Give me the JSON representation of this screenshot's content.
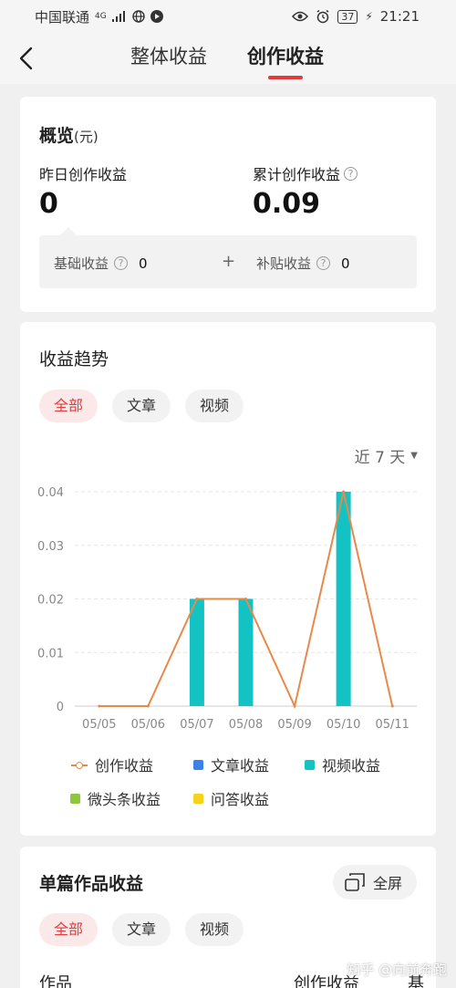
{
  "status": {
    "carrier": "中国联通",
    "network": "4G",
    "battery": "37",
    "time": "21:21"
  },
  "nav": {
    "tabs": [
      "整体收益",
      "创作收益"
    ],
    "active_tab": "创作收益"
  },
  "overview": {
    "title": "概览",
    "unit": "(元)",
    "yesterday_label": "昨日创作收益",
    "yesterday_value": "0",
    "total_label": "累计创作收益",
    "total_value": "0.09",
    "base_label": "基础收益",
    "base_value": "0",
    "plus": "+",
    "subsidy_label": "补贴收益",
    "subsidy_value": "0"
  },
  "trend": {
    "title": "收益趋势",
    "filters": [
      "全部",
      "文章",
      "视频"
    ],
    "active_filter": "全部",
    "range": "近 7 天",
    "legend": [
      {
        "name": "创作收益",
        "color": "#e8894a",
        "kind": "line"
      },
      {
        "name": "文章收益",
        "color": "#3b82e8",
        "kind": "box"
      },
      {
        "name": "视频收益",
        "color": "#13c2c2",
        "kind": "box"
      },
      {
        "name": "微头条收益",
        "color": "#8dc63f",
        "kind": "box"
      },
      {
        "name": "问答收益",
        "color": "#f5d316",
        "kind": "box"
      }
    ]
  },
  "chart_data": {
    "type": "bar",
    "categories": [
      "05/05",
      "05/06",
      "05/07",
      "05/08",
      "05/09",
      "05/10",
      "05/11"
    ],
    "y_ticks": [
      "0",
      "0.01",
      "0.02",
      "0.03",
      "0.04"
    ],
    "ylim": [
      0,
      0.04
    ],
    "series": [
      {
        "name": "视频收益",
        "type": "bar",
        "color": "#13c2c2",
        "values": [
          0,
          0,
          0.02,
          0.02,
          0,
          0.04,
          0
        ]
      },
      {
        "name": "创作收益",
        "type": "line",
        "color": "#e8894a",
        "values": [
          0,
          0,
          0.02,
          0.02,
          0,
          0.04,
          0
        ]
      }
    ],
    "grid": true,
    "legend_position": "bottom"
  },
  "works": {
    "title": "单篇作品收益",
    "fullscreen": "全屏",
    "filters": [
      "全部",
      "文章",
      "视频"
    ],
    "active_filter": "全部",
    "columns": [
      "作品",
      "创作收益",
      "基础"
    ]
  },
  "watermark": "知乎 @向前奔跑"
}
